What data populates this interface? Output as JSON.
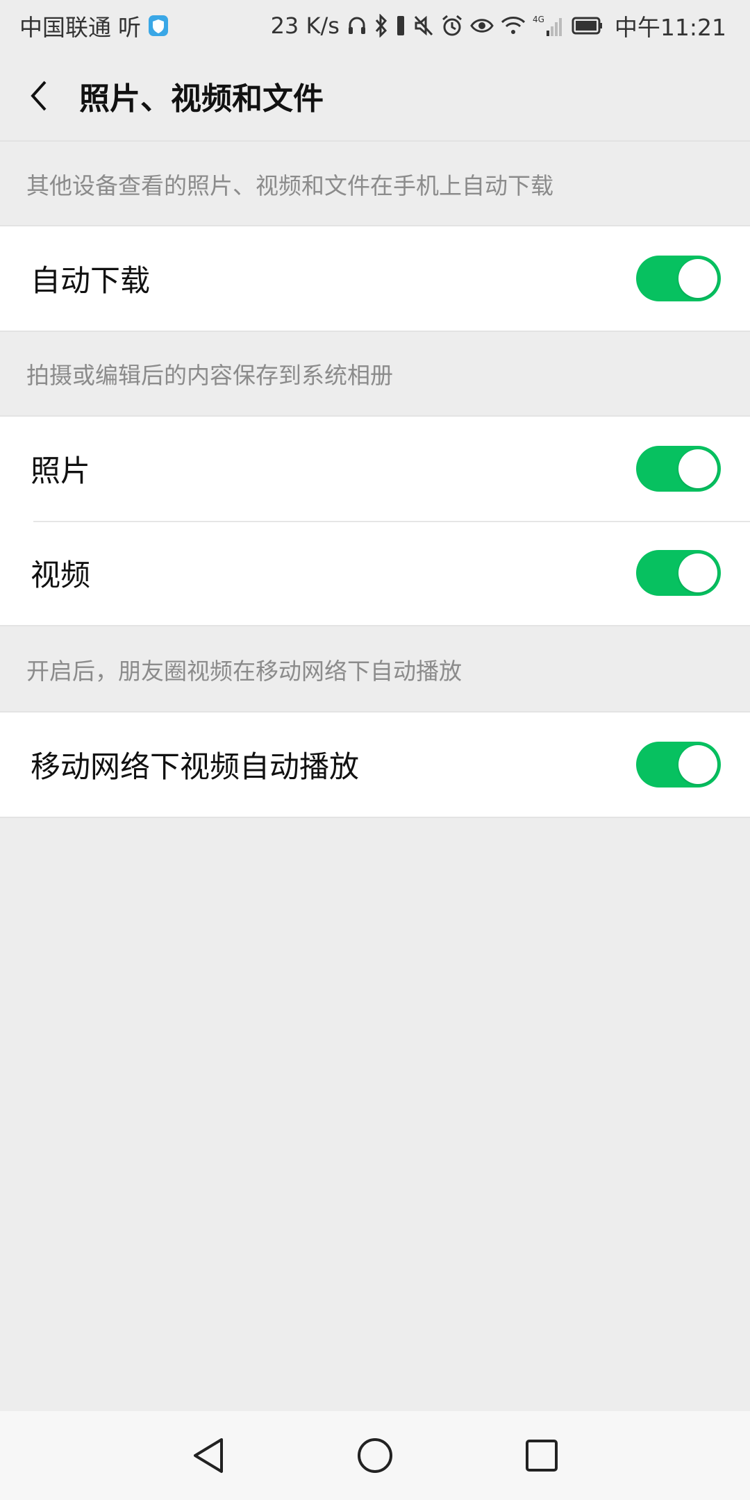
{
  "status_bar": {
    "carrier": "中国联通",
    "carrier_app": "听",
    "net_speed": "23 K/s",
    "network_type": "4G",
    "time": "中午11:21",
    "icons": [
      "shield-icon",
      "headset-icon",
      "bluetooth-icon",
      "vibrate-icon",
      "mute-icon",
      "alarm-icon",
      "eye-icon",
      "wifi-icon",
      "signal-icon",
      "battery-icon"
    ]
  },
  "header": {
    "title": "照片、视频和文件",
    "back_icon": "chevron-left-icon"
  },
  "sections": [
    {
      "hint": "其他设备查看的照片、视频和文件在手机上自动下载",
      "items": [
        {
          "label": "自动下载",
          "enabled": true
        }
      ]
    },
    {
      "hint": "拍摄或编辑后的内容保存到系统相册",
      "items": [
        {
          "label": "照片",
          "enabled": true
        },
        {
          "label": "视频",
          "enabled": true
        }
      ]
    },
    {
      "hint": "开启后，朋友圈视频在移动网络下自动播放",
      "items": [
        {
          "label": "移动网络下视频自动播放",
          "enabled": true
        }
      ]
    }
  ],
  "nav_bar": {
    "buttons": [
      "back-triangle-icon",
      "home-circle-icon",
      "recents-square-icon"
    ]
  },
  "colors": {
    "toggle_on": "#07c160",
    "background": "#ededed",
    "card": "#ffffff",
    "hint_text": "#8b8b8b"
  }
}
